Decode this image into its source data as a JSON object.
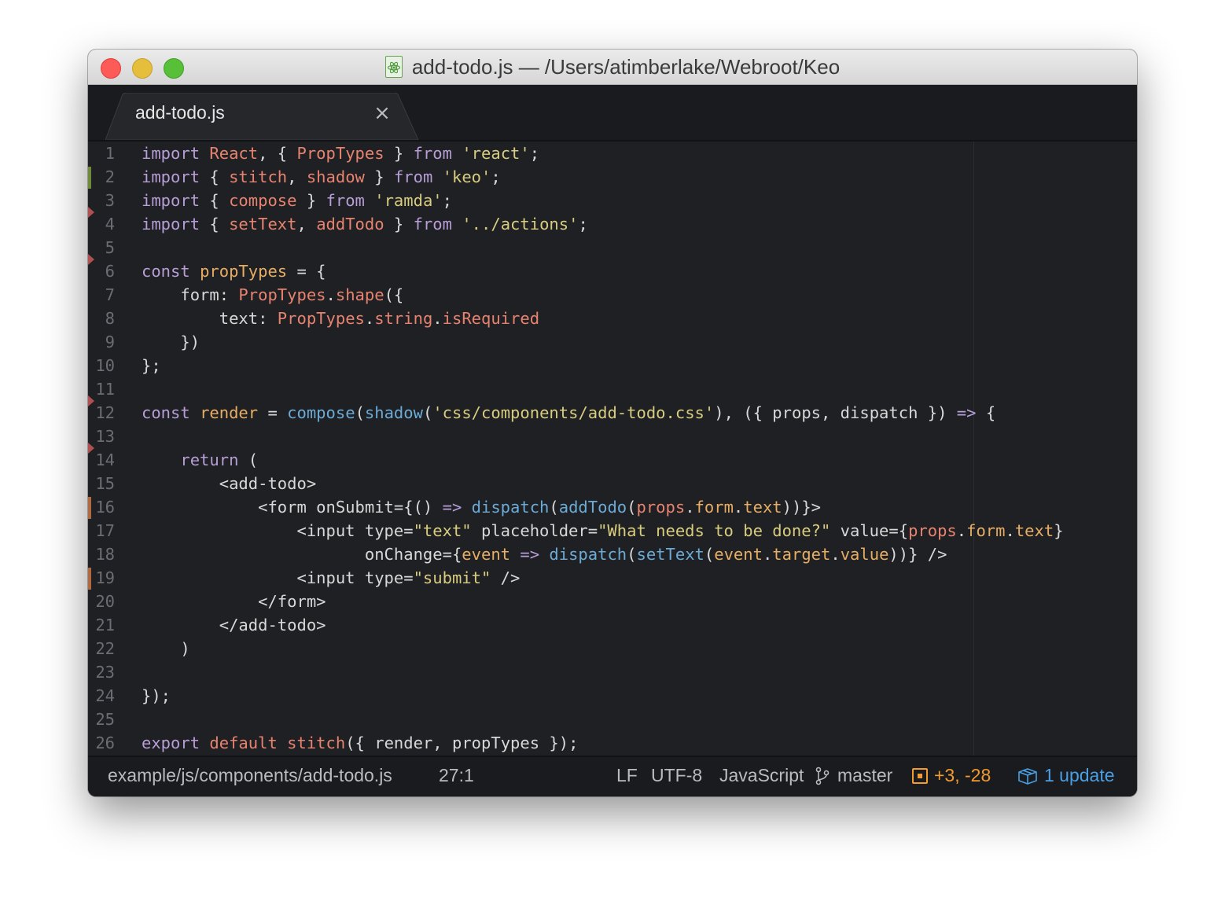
{
  "window": {
    "title": "add-todo.js — /Users/atimberlake/Webroot/Keo",
    "file_icon": "atom-react-file-icon"
  },
  "tabs": [
    {
      "label": "add-todo.js",
      "active": true,
      "close_icon": "×"
    }
  ],
  "editor": {
    "lines": [
      {
        "n": "1",
        "tokens": [
          [
            "kw",
            "import "
          ],
          [
            "id",
            "React"
          ],
          [
            "plain",
            ", { "
          ],
          [
            "id",
            "PropTypes"
          ],
          [
            "plain",
            " } "
          ],
          [
            "kw",
            "from "
          ],
          [
            "str",
            "'react'"
          ],
          [
            "plain",
            ";"
          ]
        ]
      },
      {
        "n": "2",
        "tokens": [
          [
            "kw",
            "import "
          ],
          [
            "plain",
            "{ "
          ],
          [
            "id",
            "stitch"
          ],
          [
            "plain",
            ", "
          ],
          [
            "id",
            "shadow"
          ],
          [
            "plain",
            " } "
          ],
          [
            "kw",
            "from "
          ],
          [
            "str",
            "'keo'"
          ],
          [
            "plain",
            ";"
          ]
        ]
      },
      {
        "n": "3",
        "tokens": [
          [
            "kw",
            "import "
          ],
          [
            "plain",
            "{ "
          ],
          [
            "id",
            "compose"
          ],
          [
            "plain",
            " } "
          ],
          [
            "kw",
            "from "
          ],
          [
            "str",
            "'ramda'"
          ],
          [
            "plain",
            ";"
          ]
        ]
      },
      {
        "n": "4",
        "tokens": [
          [
            "kw",
            "import "
          ],
          [
            "plain",
            "{ "
          ],
          [
            "id",
            "setText"
          ],
          [
            "plain",
            ", "
          ],
          [
            "id",
            "addTodo"
          ],
          [
            "plain",
            " } "
          ],
          [
            "kw",
            "from "
          ],
          [
            "str",
            "'../actions'"
          ],
          [
            "plain",
            ";"
          ]
        ]
      },
      {
        "n": "5",
        "tokens": []
      },
      {
        "n": "6",
        "tokens": [
          [
            "kw",
            "const "
          ],
          [
            "var",
            "propTypes"
          ],
          [
            "plain",
            " = {"
          ]
        ]
      },
      {
        "n": "7",
        "tokens": [
          [
            "plain",
            "    form: "
          ],
          [
            "id",
            "PropTypes"
          ],
          [
            "plain",
            "."
          ],
          [
            "id",
            "shape"
          ],
          [
            "plain",
            "({"
          ]
        ]
      },
      {
        "n": "8",
        "tokens": [
          [
            "plain",
            "        text: "
          ],
          [
            "id",
            "PropTypes"
          ],
          [
            "plain",
            "."
          ],
          [
            "id",
            "string"
          ],
          [
            "plain",
            "."
          ],
          [
            "id",
            "isRequired"
          ]
        ]
      },
      {
        "n": "9",
        "tokens": [
          [
            "plain",
            "    })"
          ]
        ]
      },
      {
        "n": "10",
        "tokens": [
          [
            "plain",
            "};"
          ]
        ]
      },
      {
        "n": "11",
        "tokens": []
      },
      {
        "n": "12",
        "tokens": [
          [
            "kw",
            "const "
          ],
          [
            "var",
            "render"
          ],
          [
            "plain",
            " = "
          ],
          [
            "fn",
            "compose"
          ],
          [
            "plain",
            "("
          ],
          [
            "fn",
            "shadow"
          ],
          [
            "plain",
            "("
          ],
          [
            "str",
            "'css/components/add-todo.css'"
          ],
          [
            "plain",
            "), ({ props, dispatch }) "
          ],
          [
            "kw",
            "=>"
          ],
          [
            "plain",
            " {"
          ]
        ]
      },
      {
        "n": "13",
        "tokens": []
      },
      {
        "n": "14",
        "tokens": [
          [
            "kw",
            "    return "
          ],
          [
            "plain",
            "("
          ]
        ]
      },
      {
        "n": "15",
        "tokens": [
          [
            "plain",
            "        <add-todo>"
          ]
        ]
      },
      {
        "n": "16",
        "tokens": [
          [
            "plain",
            "            <form onSubmit={() "
          ],
          [
            "kw",
            "=>"
          ],
          [
            "plain",
            " "
          ],
          [
            "fn",
            "dispatch"
          ],
          [
            "plain",
            "("
          ],
          [
            "fn",
            "addTodo"
          ],
          [
            "plain",
            "("
          ],
          [
            "id",
            "props"
          ],
          [
            "plain",
            "."
          ],
          [
            "var",
            "form"
          ],
          [
            "plain",
            "."
          ],
          [
            "var",
            "text"
          ],
          [
            "plain",
            "))}>"
          ]
        ]
      },
      {
        "n": "17",
        "tokens": [
          [
            "plain",
            "                <input type="
          ],
          [
            "str",
            "\"text\""
          ],
          [
            "plain",
            " placeholder="
          ],
          [
            "str",
            "\"What needs to be done?\""
          ],
          [
            "plain",
            " value={"
          ],
          [
            "id",
            "props"
          ],
          [
            "plain",
            "."
          ],
          [
            "var",
            "form"
          ],
          [
            "plain",
            "."
          ],
          [
            "var",
            "text"
          ],
          [
            "plain",
            "}"
          ]
        ]
      },
      {
        "n": "18",
        "tokens": [
          [
            "plain",
            "                       onChange={"
          ],
          [
            "var",
            "event"
          ],
          [
            "plain",
            " "
          ],
          [
            "kw",
            "=>"
          ],
          [
            "plain",
            " "
          ],
          [
            "fn",
            "dispatch"
          ],
          [
            "plain",
            "("
          ],
          [
            "fn",
            "setText"
          ],
          [
            "plain",
            "("
          ],
          [
            "var",
            "event"
          ],
          [
            "plain",
            "."
          ],
          [
            "var",
            "target"
          ],
          [
            "plain",
            "."
          ],
          [
            "var",
            "value"
          ],
          [
            "plain",
            "))} />"
          ]
        ]
      },
      {
        "n": "19",
        "tokens": [
          [
            "plain",
            "                <input type="
          ],
          [
            "str",
            "\"submit\""
          ],
          [
            "plain",
            " />"
          ]
        ]
      },
      {
        "n": "20",
        "tokens": [
          [
            "plain",
            "            </form>"
          ]
        ]
      },
      {
        "n": "21",
        "tokens": [
          [
            "plain",
            "        </add-todo>"
          ]
        ]
      },
      {
        "n": "22",
        "tokens": [
          [
            "plain",
            "    )"
          ]
        ]
      },
      {
        "n": "23",
        "tokens": []
      },
      {
        "n": "24",
        "tokens": [
          [
            "plain",
            "});"
          ]
        ]
      },
      {
        "n": "25",
        "tokens": []
      },
      {
        "n": "26",
        "tokens": [
          [
            "kw",
            "export "
          ],
          [
            "id",
            "default "
          ],
          [
            "id",
            "stitch"
          ],
          [
            "plain",
            "({ render, propTypes });"
          ]
        ]
      }
    ]
  },
  "status_bar": {
    "path": "example/js/components/add-todo.js",
    "cursor": "27:1",
    "line_ending": "LF",
    "encoding": "UTF-8",
    "grammar": "JavaScript",
    "branch": "master",
    "branch_icon": "git-branch-icon",
    "diff": "+3, -28",
    "diff_icon": "git-diff-icon",
    "updates": "1 update",
    "updates_icon": "package-icon"
  },
  "colors": {
    "keyword": "#b79ed6",
    "identifier": "#e8836f",
    "string": "#d8cc7e",
    "function": "#6cabd6",
    "variable": "#e6ad63",
    "diff": "#f39b2e",
    "update": "#4a9fe4"
  }
}
